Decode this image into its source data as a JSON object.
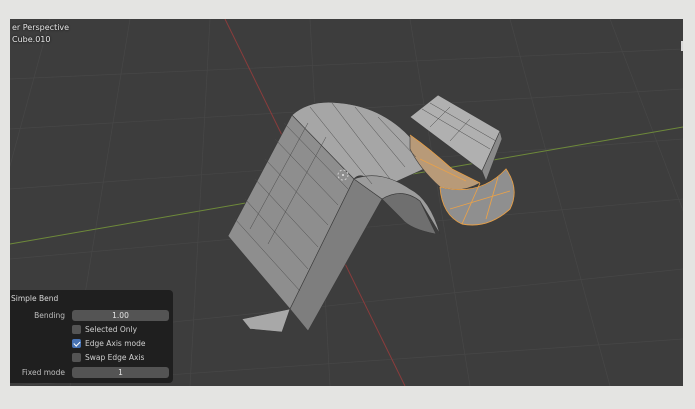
{
  "viewport": {
    "title": "er Perspective",
    "object_name": "Cube.010"
  },
  "operator_panel": {
    "title": "Simple Bend",
    "bending_label": "Bending",
    "bending_value": "1.00",
    "selected_only_label": "Selected Only",
    "selected_only_checked": false,
    "edge_axis_mode_label": "Edge Axis mode",
    "edge_axis_mode_checked": true,
    "swap_edge_axis_label": "Swap Edge Axis",
    "swap_edge_axis_checked": false,
    "fixed_mode_label": "Fixed mode",
    "fixed_mode_value": "1"
  },
  "colors": {
    "viewport_bg": "#3d3d3d",
    "mesh_face": "#9a9a9a",
    "selected_edges": "#e8a14a",
    "x_axis": "#8a3c3c",
    "y_axis": "#6e8a3a",
    "checkbox_on": "#4772b3"
  }
}
